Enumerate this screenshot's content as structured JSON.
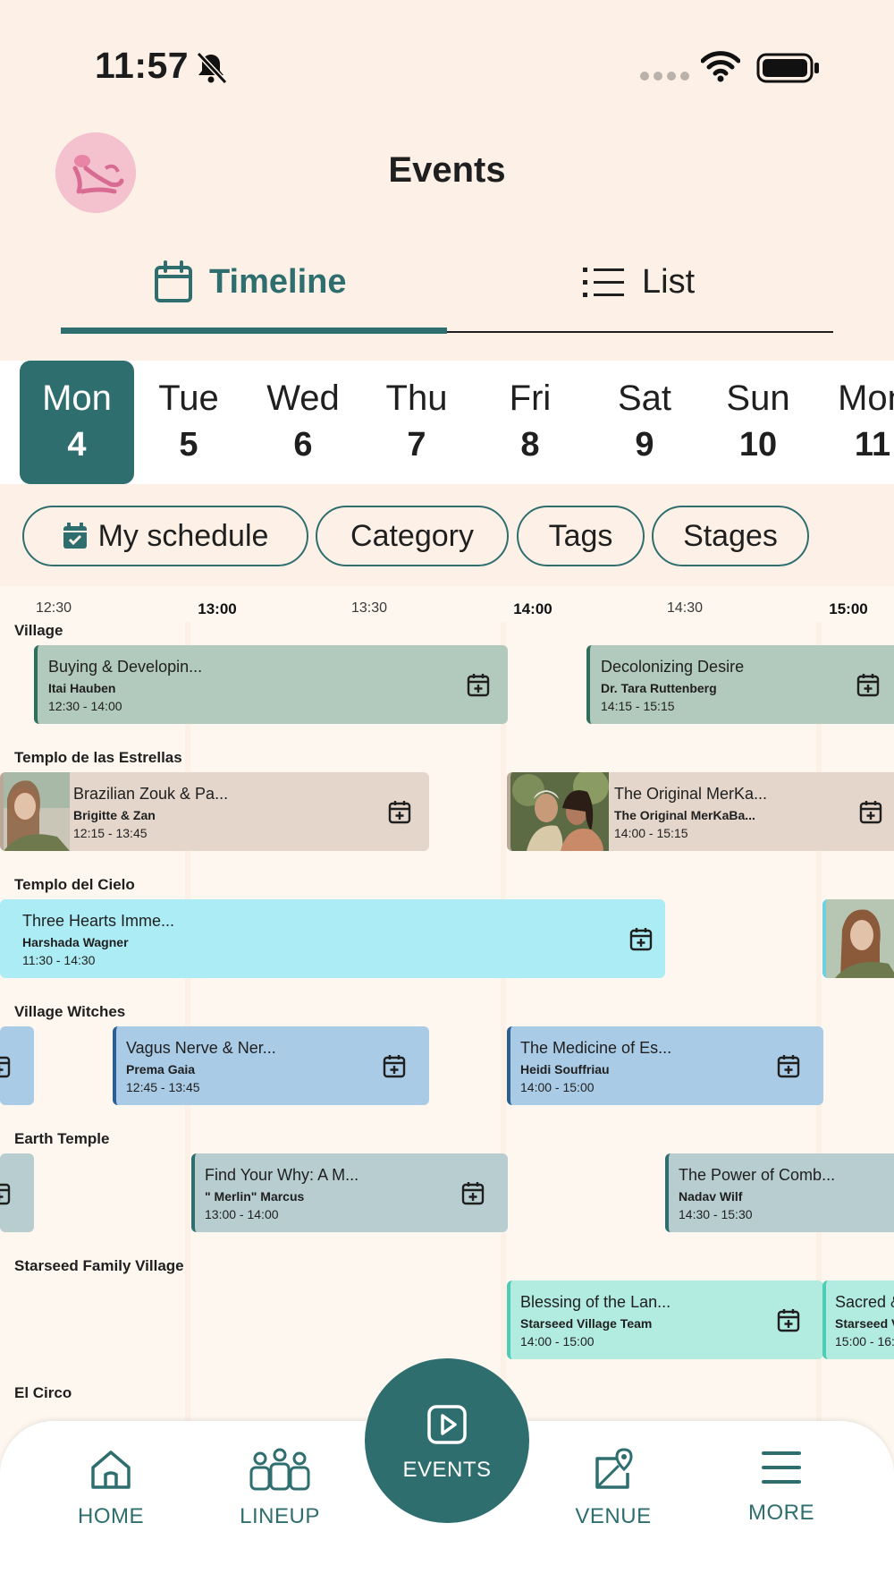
{
  "status_bar": {
    "time": "11:57"
  },
  "header": {
    "title": "Events"
  },
  "tabs": {
    "timeline": "Timeline",
    "list": "List"
  },
  "days": [
    {
      "name": "Mon",
      "num": "4"
    },
    {
      "name": "Tue",
      "num": "5"
    },
    {
      "name": "Wed",
      "num": "6"
    },
    {
      "name": "Thu",
      "num": "7"
    },
    {
      "name": "Fri",
      "num": "8"
    },
    {
      "name": "Sat",
      "num": "9"
    },
    {
      "name": "Sun",
      "num": "10"
    },
    {
      "name": "Mon",
      "num": "11"
    }
  ],
  "filters": {
    "my_schedule": "My schedule",
    "category": "Category",
    "tags": "Tags",
    "stages": "Stages"
  },
  "time_ticks": [
    "12:30",
    "13:00",
    "13:30",
    "14:00",
    "14:30",
    "15:00"
  ],
  "stages": [
    "Village",
    "Templo de las Estrellas",
    "Templo del Cielo",
    "Village Witches",
    "Earth Temple",
    "Starseed Family Village",
    "El Circo"
  ],
  "events": [
    {
      "title": "Buying & Developin...",
      "artist": "Itai Hauben",
      "time": "12:30 - 14:00"
    },
    {
      "title": "Decolonizing Desire",
      "artist": "Dr. Tara Ruttenberg",
      "time": "14:15 - 15:15"
    },
    {
      "title": "Brazilian Zouk & Pa...",
      "artist": "Brigitte & Zan",
      "time": "12:15 - 13:45"
    },
    {
      "title": "The Original MerKa...",
      "artist": "The Original MerKaBa...",
      "time": "14:00 - 15:15"
    },
    {
      "title": "Three Hearts Imme...",
      "artist": "Harshada Wagner",
      "time": "11:30 - 14:30"
    },
    {
      "title": "Vagus Nerve & Ner...",
      "artist": "Prema Gaia",
      "time": "12:45 - 13:45"
    },
    {
      "title": "The Medicine of Es...",
      "artist": "Heidi Souffriau",
      "time": "14:00 - 15:00"
    },
    {
      "title": "Find Your Why: A M...",
      "artist": "\" Merlin\" Marcus",
      "time": "13:00 - 14:00"
    },
    {
      "title": "The Power of Comb...",
      "artist": "Nadav Wilf",
      "time": "14:30 - 15:30"
    },
    {
      "title": "Blessing of the Lan...",
      "artist": "Starseed Village Team",
      "time": "14:00 - 15:00"
    },
    {
      "title": "Sacred &",
      "artist": "Starseed V",
      "time": "15:00 - 16:"
    }
  ],
  "nav": {
    "home": "HOME",
    "lineup": "LINEUP",
    "events": "EVENTS",
    "venue": "VENUE",
    "more": "MORE"
  },
  "colors": {
    "accent": "#2f6e6e",
    "background": "#fdf1e7"
  }
}
